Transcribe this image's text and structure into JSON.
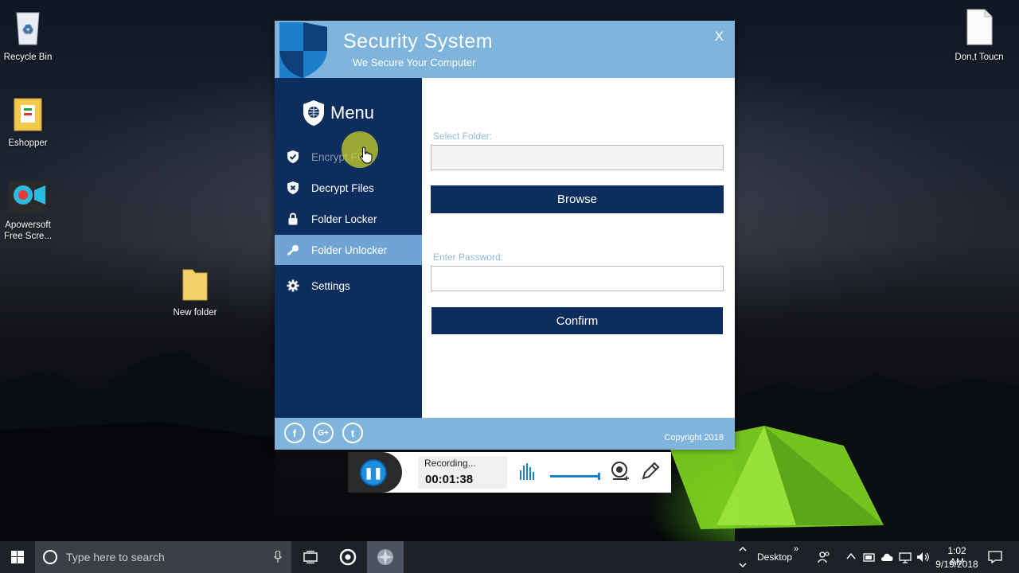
{
  "desktop": {
    "icons": [
      {
        "label": "Recycle Bin"
      },
      {
        "label": "Eshopper"
      },
      {
        "label": "Apowersoft Free Scre..."
      },
      {
        "label": "New folder"
      },
      {
        "label": "Don,t Toucn"
      }
    ]
  },
  "app": {
    "title": "Security System",
    "subtitle": "We Secure Your Computer",
    "close_label": "X",
    "menu_title": "Menu",
    "nav": [
      {
        "label": "Encrypt Files",
        "icon": "shield-check-icon",
        "state": "hovered"
      },
      {
        "label": "Decrypt Files",
        "icon": "shield-x-icon"
      },
      {
        "label": "Folder Locker",
        "icon": "lock-icon"
      },
      {
        "label": "Folder Unlocker",
        "icon": "key-icon",
        "state": "active"
      },
      {
        "label": "Settings",
        "icon": "gear-icon"
      }
    ],
    "form": {
      "folder_label": "Select Folder:",
      "folder_value": "",
      "browse_label": "Browse",
      "password_label": "Enter Password:",
      "password_value": "",
      "confirm_label": "Confirm"
    },
    "footer": {
      "social": [
        {
          "icon": "facebook-icon",
          "glyph": "f"
        },
        {
          "icon": "google-plus-icon",
          "glyph": "G+"
        },
        {
          "icon": "twitter-icon",
          "glyph": "t"
        }
      ],
      "copyright": "Copyright 2018"
    },
    "colors": {
      "header": "#7fb4dc",
      "sidebar": "#0d2d5e",
      "active_item": "#6fa4d4",
      "button": "#0d2d5e"
    }
  },
  "recorder": {
    "status": "Recording...",
    "time": "00:01:38"
  },
  "taskbar": {
    "search_placeholder": "Type here to search",
    "desktop_label": "Desktop",
    "time": "1:02 AM",
    "date": "9/19/2018"
  }
}
